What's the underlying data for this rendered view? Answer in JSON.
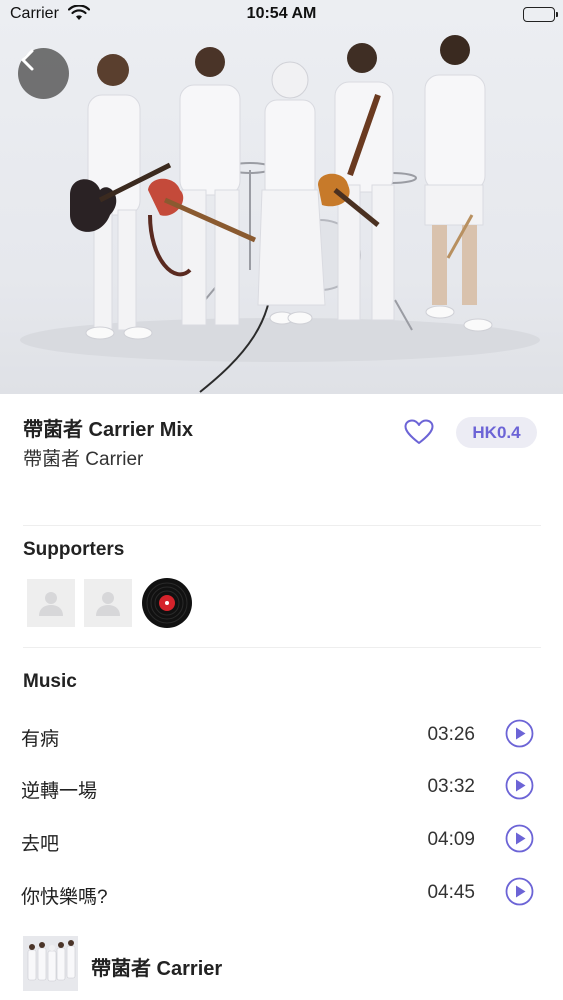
{
  "status_bar": {
    "carrier": "Carrier",
    "time": "10:54 AM",
    "wifi_icon": "wifi-icon",
    "battery_icon": "battery-icon"
  },
  "hero": {
    "image": "band-photo",
    "back_icon": "chevron-left-icon"
  },
  "album": {
    "title": "帶菌者 Carrier Mix",
    "artist": "帶菌者 Carrier",
    "price": "HK0.4",
    "favorite_icon": "heart-icon"
  },
  "supporters": {
    "title": "Supporters",
    "avatars": [
      "person-placeholder-icon",
      "person-placeholder-icon",
      "vinyl-record-icon"
    ]
  },
  "music": {
    "title": "Music",
    "tracks": [
      {
        "name": "有病",
        "duration": "03:26"
      },
      {
        "name": "逆轉一場",
        "duration": "03:32"
      },
      {
        "name": "去吧",
        "duration": "04:09"
      },
      {
        "name": "你快樂嗎?",
        "duration": "04:45"
      }
    ]
  },
  "artist": {
    "name": "帶菌者 Carrier"
  },
  "colors": {
    "accent": "#6c64d6",
    "badge_bg": "#ececf4",
    "back_button_bg": "#5a5a5a",
    "divider": "#eeeeee"
  }
}
